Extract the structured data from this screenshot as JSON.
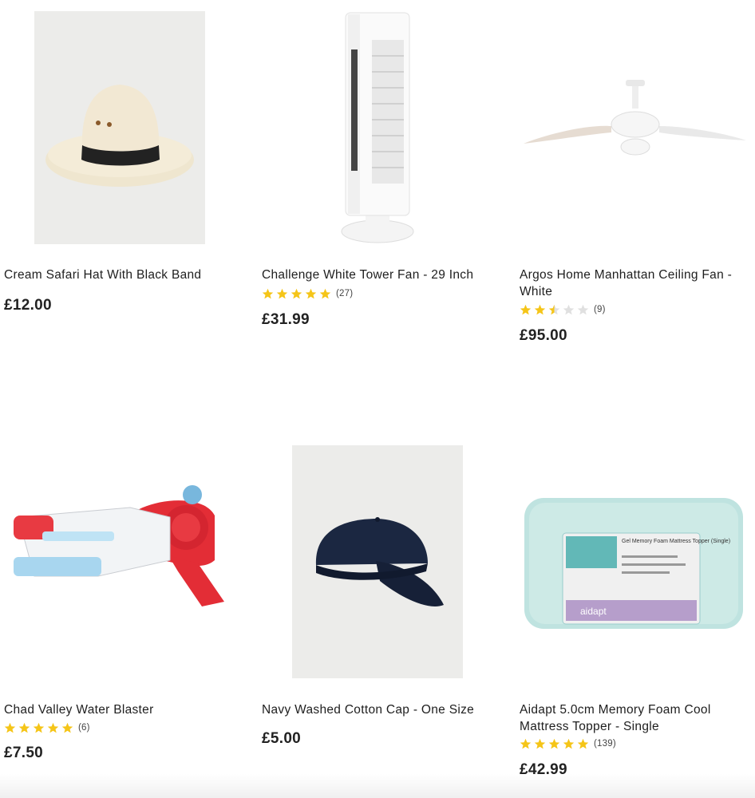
{
  "products": [
    {
      "title": "Cream Safari Hat With Black Band",
      "price": "£12.00",
      "image": "cream-safari-hat-image"
    },
    {
      "title": "Challenge White Tower Fan - 29 Inch",
      "price": "£31.99",
      "rating": 5,
      "review_count": "(27)",
      "image": "tower-fan-image"
    },
    {
      "title": "Argos Home Manhattan Ceiling Fan - White",
      "price": "£95.00",
      "rating": 2.5,
      "review_count": "(9)",
      "image": "ceiling-fan-image"
    },
    {
      "title": "Chad Valley Water Blaster",
      "price": "£7.50",
      "rating": 5,
      "review_count": "(6)",
      "image": "water-blaster-image"
    },
    {
      "title": "Navy Washed Cotton Cap - One Size",
      "price": "£5.00",
      "image": "navy-cap-image"
    },
    {
      "title": "Aidapt 5.0cm Memory Foam Cool Mattress Topper - Single",
      "price": "£42.99",
      "rating": 5,
      "review_count": "(139)",
      "image": "mattress-topper-image",
      "package_text": {
        "heading": "Gel Memory Foam Mattress Topper (Single)",
        "brand": "aidapt"
      }
    }
  ],
  "colors": {
    "star_filled": "#f5c518",
    "star_empty": "#e0e0e0",
    "text": "#1e1e1e"
  }
}
